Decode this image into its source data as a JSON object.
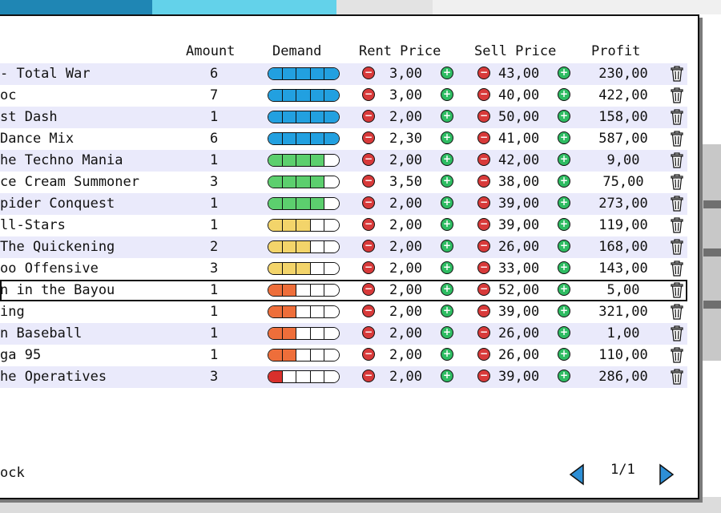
{
  "colors": {
    "demand_blue": "#22a0e0",
    "demand_green": "#5ccf6e",
    "demand_yellow": "#f3d46a",
    "demand_orange": "#ee6e3a",
    "demand_red": "#d9302c",
    "minus_button": "#d83a3a",
    "plus_button": "#2ebc62",
    "row_alt": "#eaeafb",
    "arrow": "#2d8fd6"
  },
  "headers": {
    "amount": "Amount",
    "demand": "Demand",
    "rent_price": "Rent Price",
    "sell_price": "Sell Price",
    "profit": "Profit"
  },
  "rows": [
    {
      "name": "- Total War",
      "amount": "6",
      "demand": 5,
      "rent": "3,00",
      "sell": "43,00",
      "profit": "230,00"
    },
    {
      "name": "oc",
      "amount": "7",
      "demand": 5,
      "rent": "3,00",
      "sell": "40,00",
      "profit": "422,00"
    },
    {
      "name": "st Dash",
      "amount": "1",
      "demand": 5,
      "rent": "2,00",
      "sell": "50,00",
      "profit": "158,00"
    },
    {
      "name": "Dance Mix",
      "amount": "6",
      "demand": 5,
      "rent": "2,30",
      "sell": "41,00",
      "profit": "587,00"
    },
    {
      "name": "he Techno Mania",
      "amount": "1",
      "demand": 4,
      "rent": "2,00",
      "sell": "42,00",
      "profit": "9,00"
    },
    {
      "name": "ce Cream Summoner",
      "amount": "3",
      "demand": 4,
      "rent": "3,50",
      "sell": "38,00",
      "profit": "75,00"
    },
    {
      "name": "pider Conquest",
      "amount": "1",
      "demand": 4,
      "rent": "2,00",
      "sell": "39,00",
      "profit": "273,00"
    },
    {
      "name": "ll-Stars",
      "amount": "1",
      "demand": 3,
      "rent": "2,00",
      "sell": "39,00",
      "profit": "119,00"
    },
    {
      "name": "The Quickening",
      "amount": "2",
      "demand": 3,
      "rent": "2,00",
      "sell": "26,00",
      "profit": "168,00"
    },
    {
      "name": "oo Offensive",
      "amount": "3",
      "demand": 3,
      "rent": "2,00",
      "sell": "33,00",
      "profit": "143,00"
    },
    {
      "name": "n in the Bayou",
      "amount": "1",
      "demand": 2,
      "rent": "2,00",
      "sell": "52,00",
      "profit": "5,00"
    },
    {
      "name": "ing",
      "amount": "1",
      "demand": 2,
      "rent": "2,00",
      "sell": "39,00",
      "profit": "321,00"
    },
    {
      "name": "n Baseball",
      "amount": "1",
      "demand": 2,
      "rent": "2,00",
      "sell": "26,00",
      "profit": "1,00"
    },
    {
      "name": "ga 95",
      "amount": "1",
      "demand": 2,
      "rent": "2,00",
      "sell": "26,00",
      "profit": "110,00"
    },
    {
      "name": "he Operatives",
      "amount": "3",
      "demand": 1,
      "rent": "2,00",
      "sell": "39,00",
      "profit": "286,00"
    }
  ],
  "footer": {
    "back_label": "ock",
    "page": "1/1"
  },
  "icons": {
    "minus": "−",
    "plus": "+",
    "trash": "trash-icon",
    "prev": "arrow-left-icon",
    "next": "arrow-right-icon"
  }
}
